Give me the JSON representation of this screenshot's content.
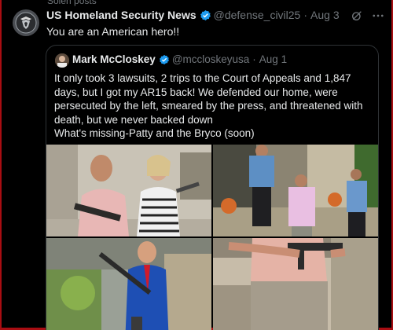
{
  "top_cut_text": "Solen posts",
  "tweet": {
    "author_name": "US Homeland Security News",
    "handle": "@defense_civil25",
    "separator": "·",
    "date": "Aug 3",
    "text": "You are an American hero!!"
  },
  "quote": {
    "author_name": "Mark McCloskey",
    "handle": "@mccloskeyusa",
    "separator": "·",
    "date": "Aug 1",
    "text_line1": "It only took 3 lawsuits, 2 trips to the Court of Appeals and 1,847 days, but I got my AR15 back! We defended our home, were persecuted by the left, smeared by the press, and threatened with death, but we never backed down",
    "text_line2": "What's missing-Patty and the Bryco (soon)"
  },
  "colors": {
    "background": "#000000",
    "verified_blue": "#1d9bf0",
    "border_red": "#a80d12",
    "muted_text": "#71767b"
  },
  "icons": [
    "shield-logo-icon",
    "verified-badge-icon",
    "grok-icon",
    "more-icon"
  ]
}
